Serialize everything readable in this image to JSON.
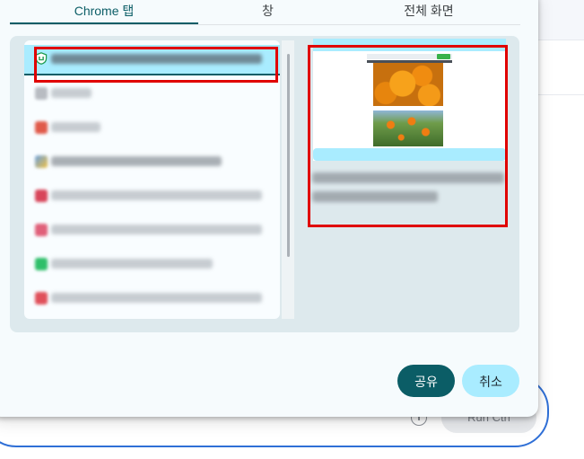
{
  "dialog": {
    "tabs": [
      {
        "label": "Chrome 탭",
        "active": true
      },
      {
        "label": "창",
        "active": false
      },
      {
        "label": "전체 화면",
        "active": false
      }
    ],
    "share_label": "공유",
    "cancel_label": "취소"
  },
  "tab_list": {
    "items": [
      {
        "favicon": "shield-favicon",
        "favicon_color": "#1e9b4f",
        "selected": true
      },
      {
        "favicon": "blurred-favicon",
        "favicon_color": "#b8bcc2",
        "selected": false
      },
      {
        "favicon": "blurred-favicon",
        "favicon_color": "#e05a4a",
        "selected": false
      },
      {
        "favicon": "blurred-favicon",
        "favicon_color": "#6aa0e0",
        "selected": false
      },
      {
        "favicon": "blurred-favicon",
        "favicon_color": "#d8455a",
        "selected": false
      },
      {
        "favicon": "blurred-favicon",
        "favicon_color": "#e0607a",
        "selected": false
      },
      {
        "favicon": "blurred-favicon",
        "favicon_color": "#2fbf6a",
        "selected": false
      },
      {
        "favicon": "blurred-favicon",
        "favicon_color": "#e0505a",
        "selected": false
      }
    ]
  },
  "background": {
    "run_label": "Run  Ctrl"
  },
  "colors": {
    "accent": "#0b5d66",
    "selected_bg": "#a9ecff",
    "highlight": "#e00000"
  }
}
